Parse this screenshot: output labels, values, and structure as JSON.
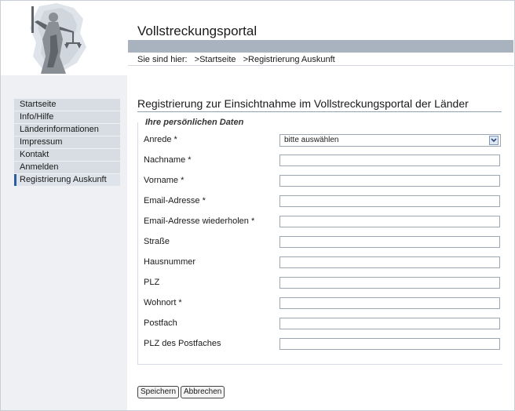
{
  "header": {
    "site_title": "Vollstreckungsportal",
    "breadcrumb_label": "Sie sind hier:",
    "breadcrumbs": [
      ">Startseite",
      ">Registrierung Auskunft"
    ]
  },
  "sidebar": {
    "items": [
      {
        "label": "Startseite",
        "active": false
      },
      {
        "label": "Info/Hilfe",
        "active": false
      },
      {
        "label": "Länderinformationen",
        "active": false
      },
      {
        "label": "Impressum",
        "active": false
      },
      {
        "label": "Kontakt",
        "active": false
      },
      {
        "label": "Anmelden",
        "active": false
      },
      {
        "label": "Registrierung Auskunft",
        "active": true
      }
    ]
  },
  "main": {
    "heading": "Registrierung zur Einsichtnahme im Vollstreckungsportal der Länder",
    "fieldset_legend": "Ihre persönlichen Daten",
    "fields": [
      {
        "label": "Anrede *",
        "type": "select",
        "value": "bitte auswählen"
      },
      {
        "label": "Nachname *",
        "type": "text",
        "value": ""
      },
      {
        "label": "Vorname *",
        "type": "text",
        "value": ""
      },
      {
        "label": "Email-Adresse *",
        "type": "text",
        "value": ""
      },
      {
        "label": "Email-Adresse wiederholen *",
        "type": "text",
        "value": ""
      },
      {
        "label": "Straße",
        "type": "text",
        "value": ""
      },
      {
        "label": "Hausnummer",
        "type": "text",
        "value": ""
      },
      {
        "label": "PLZ",
        "type": "text",
        "value": ""
      },
      {
        "label": "Wohnort *",
        "type": "text",
        "value": ""
      },
      {
        "label": "Postfach",
        "type": "text",
        "value": ""
      },
      {
        "label": "PLZ des Postfaches",
        "type": "text",
        "value": ""
      }
    ]
  },
  "buttons": {
    "save": "Speichern",
    "cancel": "Abbrechen"
  },
  "colors": {
    "header_bar": "#a9b3bf",
    "nav_item_bg": "#d7dde3",
    "active_marker": "#2c5da0",
    "heading_line": "#8fa1b6"
  }
}
